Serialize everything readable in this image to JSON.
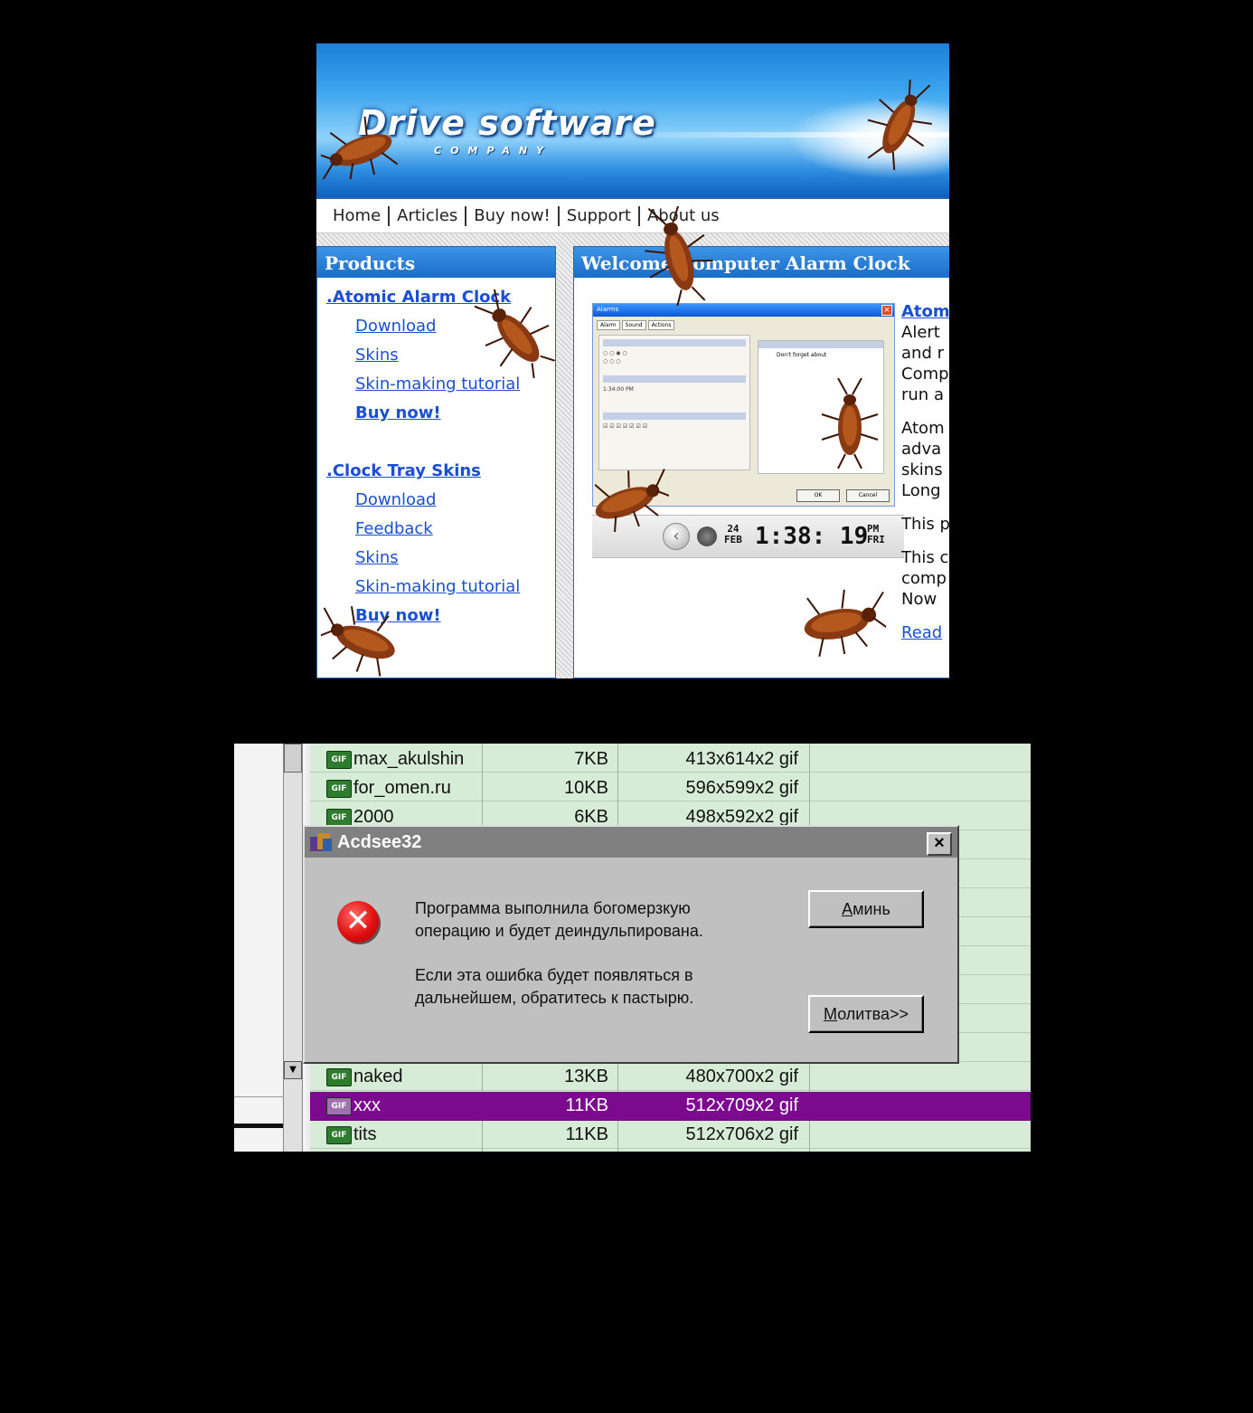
{
  "website": {
    "brand_title": "Drive software",
    "brand_subtitle": "COMPANY",
    "nav": [
      "Home",
      "Articles",
      "Buy now!",
      "Support",
      "About us"
    ],
    "products_heading": "Products",
    "welcome_heading": "Welcome Computer Alarm Clock",
    "products": [
      {
        "name": ".Atomic Alarm Clock",
        "links": [
          "Download",
          "Skins",
          "Skin-making tutorial"
        ],
        "buy": "Buy now!"
      },
      {
        "name": ".Clock Tray Skins",
        "links": [
          "Download",
          "Feedback",
          "Skins",
          "Skin-making tutorial"
        ],
        "buy": "Buy now!"
      }
    ],
    "alarm_dialog": {
      "title": "Alarms",
      "tabs": [
        "Alarm",
        "Sound",
        "Actions"
      ],
      "message_text": "Don't forget about",
      "ok": "OK",
      "cancel": "Cancel",
      "time_value": "1:34:00 PM"
    },
    "clock": {
      "day": "24",
      "month": "FEB",
      "time": "1:38: 19",
      "ampm": "PM",
      "weekday": "FRI"
    },
    "intro_lines": [
      {
        "link": "Atom",
        "text": [
          "Alert",
          "and r",
          "Comp",
          "run a"
        ]
      },
      {
        "text": [
          "Atom",
          "adva",
          "skins",
          "Long"
        ]
      },
      {
        "text": [
          "This p"
        ]
      },
      {
        "text": [
          "This c",
          "comp",
          "Now"
        ]
      },
      {
        "link": "Read"
      }
    ],
    "colors": {
      "banner": "#3aa3ee",
      "panel_head": "#1b6dc7",
      "link": "#1a4fcf"
    }
  },
  "file_list": {
    "rows_top": [
      {
        "icon": "GIF",
        "name": "max_akulshin",
        "size": "7KB",
        "dims": "413x614x2 gif"
      },
      {
        "icon": "GIF",
        "name": "for_omen.ru",
        "size": "10KB",
        "dims": "596x599x2 gif"
      },
      {
        "icon": "GIF",
        "name": "2000",
        "size": "6KB",
        "dims": "498x592x2 gif"
      }
    ],
    "rows_bottom": [
      {
        "icon": "GIF",
        "name": "naked",
        "size": "13KB",
        "dims": "480x700x2 gif"
      },
      {
        "icon": "GIF",
        "name": "xxx",
        "size": "11KB",
        "dims": "512x709x2 gif",
        "selected": true
      },
      {
        "icon": "GIF",
        "name": "tits",
        "size": "11KB",
        "dims": "512x706x2 gif"
      }
    ],
    "colors": {
      "row_bg": "#d7ecd6",
      "selected_bg": "#7b0a8e"
    }
  },
  "error_dialog": {
    "title": "Acdsee32",
    "close": "×",
    "message1": [
      "Программа выполнила богомерзкую",
      "операцию и будет деиндульпирована."
    ],
    "message2": [
      "Если эта ошибка будет появляться в",
      "дальнейшем, обратитесь к пастырю."
    ],
    "button_amen_underline": "А",
    "button_amen_rest": "минь",
    "button_pray_underline": "М",
    "button_pray_rest": "олитва>>",
    "icon": "error-x-icon"
  }
}
